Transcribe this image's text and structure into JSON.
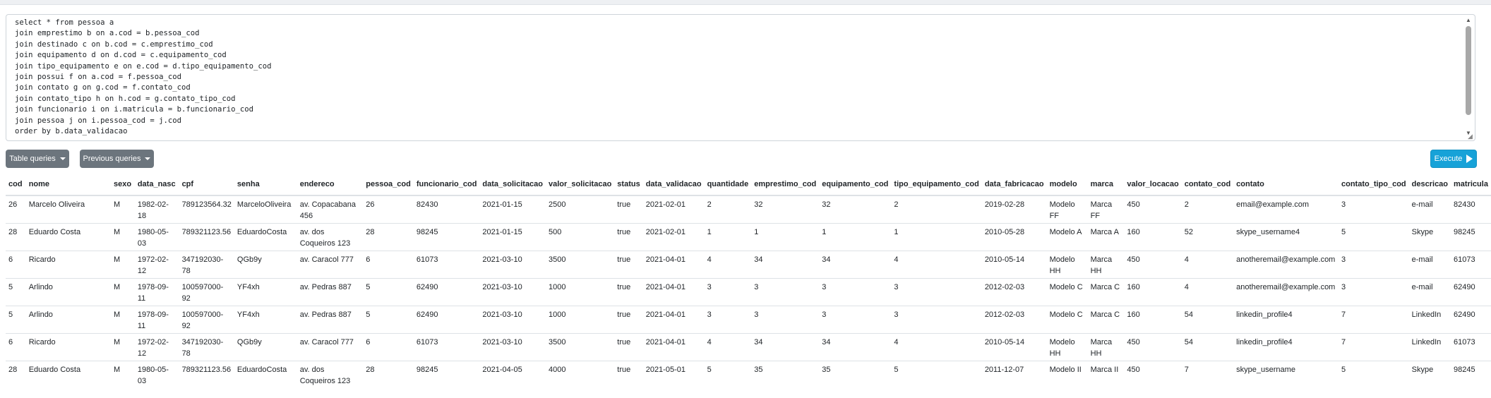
{
  "editor": {
    "query": "select * from pessoa a\njoin emprestimo b on a.cod = b.pessoa_cod\njoin destinado c on b.cod = c.emprestimo_cod\njoin equipamento d on d.cod = c.equipamento_cod\njoin tipo_equipamento e on e.cod = d.tipo_equipamento_cod\njoin possui f on a.cod = f.pessoa_cod\njoin contato g on g.cod = f.contato_cod\njoin contato_tipo h on h.cod = g.contato_tipo_cod\njoin funcionario i on i.matricula = b.funcionario_cod\njoin pessoa j on i.pessoa_cod = j.cod\norder by b.data_validacao"
  },
  "toolbar": {
    "table_queries_label": "Table queries",
    "previous_queries_label": "Previous queries",
    "execute_label": "Execute"
  },
  "colors": {
    "execute": "#17a2d8",
    "secondary": "#6c757d"
  },
  "table": {
    "columns": [
      "cod",
      "nome",
      "sexo",
      "data_nasc",
      "cpf",
      "senha",
      "endereco",
      "pessoa_cod",
      "funcionario_cod",
      "data_solicitacao",
      "valor_solicitacao",
      "status",
      "data_validacao",
      "quantidade",
      "emprestimo_cod",
      "equipamento_cod",
      "tipo_equipamento_cod",
      "data_fabricacao",
      "modelo",
      "marca",
      "valor_locacao",
      "contato_cod",
      "contato",
      "contato_tipo_cod",
      "descricao",
      "matricula"
    ],
    "rows": [
      [
        "26",
        "Marcelo Oliveira",
        "M",
        "1982-02-18",
        "789123564.32",
        "MarceloOliveira",
        "av. Copacabana 456",
        "26",
        "82430",
        "2021-01-15",
        "2500",
        "true",
        "2021-02-01",
        "2",
        "32",
        "32",
        "2",
        "2019-02-28",
        "Modelo FF",
        "Marca FF",
        "450",
        "2",
        "email@example.com",
        "3",
        "e-mail",
        "82430"
      ],
      [
        "28",
        "Eduardo Costa",
        "M",
        "1980-05-03",
        "789321123.56",
        "EduardoCosta",
        "av. dos Coqueiros 123",
        "28",
        "98245",
        "2021-01-15",
        "500",
        "true",
        "2021-02-01",
        "1",
        "1",
        "1",
        "1",
        "2010-05-28",
        "Modelo A",
        "Marca A",
        "160",
        "52",
        "skype_username4",
        "5",
        "Skype",
        "98245"
      ],
      [
        "6",
        "Ricardo",
        "M",
        "1972-02-12",
        "347192030-78",
        "QGb9y",
        "av. Caracol 777",
        "6",
        "61073",
        "2021-03-10",
        "3500",
        "true",
        "2021-04-01",
        "4",
        "34",
        "34",
        "4",
        "2010-05-14",
        "Modelo HH",
        "Marca HH",
        "450",
        "4",
        "anotheremail@example.com",
        "3",
        "e-mail",
        "61073"
      ],
      [
        "5",
        "Arlindo",
        "M",
        "1978-09-11",
        "100597000-92",
        "YF4xh",
        "av. Pedras 887",
        "5",
        "62490",
        "2021-03-10",
        "1000",
        "true",
        "2021-04-01",
        "3",
        "3",
        "3",
        "3",
        "2012-02-03",
        "Modelo C",
        "Marca C",
        "160",
        "4",
        "anotheremail@example.com",
        "3",
        "e-mail",
        "62490"
      ],
      [
        "5",
        "Arlindo",
        "M",
        "1978-09-11",
        "100597000-92",
        "YF4xh",
        "av. Pedras 887",
        "5",
        "62490",
        "2021-03-10",
        "1000",
        "true",
        "2021-04-01",
        "3",
        "3",
        "3",
        "3",
        "2012-02-03",
        "Modelo C",
        "Marca C",
        "160",
        "54",
        "linkedin_profile4",
        "7",
        "LinkedIn",
        "62490"
      ],
      [
        "6",
        "Ricardo",
        "M",
        "1972-02-12",
        "347192030-78",
        "QGb9y",
        "av. Caracol 777",
        "6",
        "61073",
        "2021-03-10",
        "3500",
        "true",
        "2021-04-01",
        "4",
        "34",
        "34",
        "4",
        "2010-05-14",
        "Modelo HH",
        "Marca HH",
        "450",
        "54",
        "linkedin_profile4",
        "7",
        "LinkedIn",
        "61073"
      ],
      [
        "28",
        "Eduardo Costa",
        "M",
        "1980-05-03",
        "789321123.56",
        "EduardoCosta",
        "av. dos Coqueiros 123",
        "28",
        "98245",
        "2021-04-05",
        "4000",
        "true",
        "2021-05-01",
        "5",
        "35",
        "35",
        "5",
        "2011-12-07",
        "Modelo II",
        "Marca II",
        "450",
        "7",
        "skype_username",
        "5",
        "Skype",
        "98245"
      ]
    ]
  }
}
